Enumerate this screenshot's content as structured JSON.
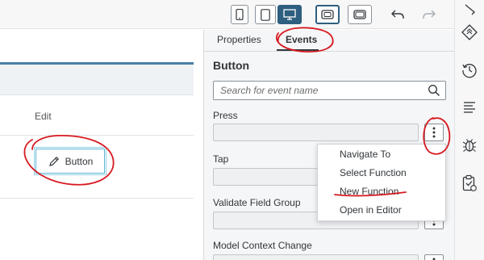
{
  "toolbar": {
    "device_buttons": [
      "phone-icon",
      "tablet-icon",
      "desktop-icon"
    ],
    "frame_buttons": [
      "frame-small-icon",
      "frame-large-icon"
    ],
    "history_buttons": [
      "undo-icon",
      "redo-icon"
    ]
  },
  "canvas": {
    "column_header": "Edit",
    "button_label": "Button"
  },
  "panel": {
    "tabs": [
      {
        "label": "Properties"
      },
      {
        "label": "Events"
      }
    ],
    "title": "Button",
    "search": {
      "placeholder": "Search for event name"
    },
    "fields": [
      {
        "label": "Press"
      },
      {
        "label": "Tap"
      },
      {
        "label": "Validate Field Group"
      },
      {
        "label": "Model Context Change"
      }
    ],
    "menu": {
      "items": [
        {
          "label": "Navigate To"
        },
        {
          "label": "Select Function"
        },
        {
          "label": "New Function"
        },
        {
          "label": "Open in Editor"
        }
      ]
    }
  },
  "side_toolbar": {
    "icons": [
      "ruler-icon",
      "stylesheet-icon",
      "history-icon",
      "outline-icon",
      "debug-icon",
      "clipboard-icon"
    ]
  },
  "colors": {
    "accent": "#2e5f80",
    "annotation": "#d71920",
    "selection": "#5ab4d6"
  }
}
